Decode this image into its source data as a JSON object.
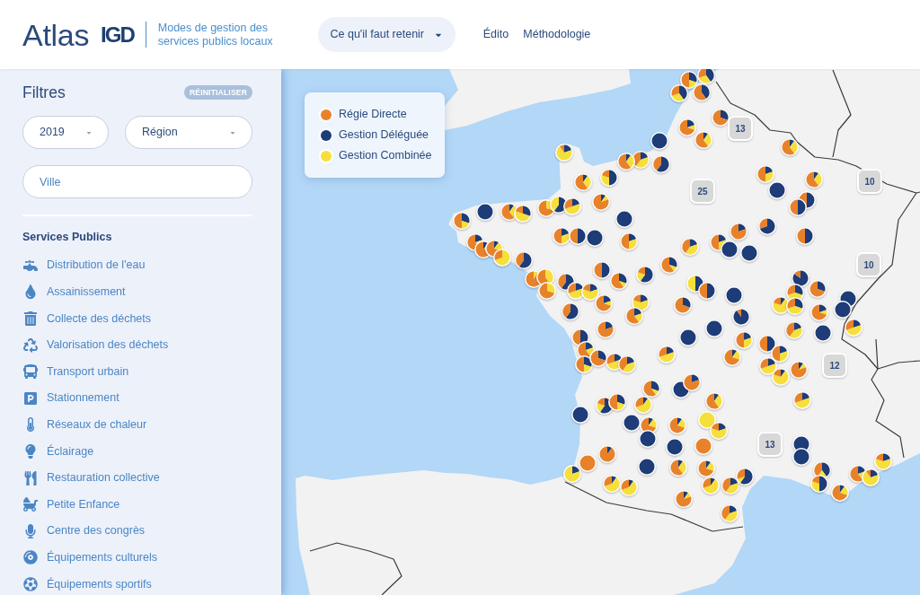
{
  "header": {
    "title": "Atlas",
    "brand": "IGD",
    "subtitle": "Modes de gestion des services publics locaux",
    "menu_button": "Ce qu'il faut retenir",
    "nav_links": [
      "Édito",
      "Méthodologie"
    ]
  },
  "sidebar": {
    "title": "Filtres",
    "reset_button": "RÉINITIALISER",
    "year_select": "2019",
    "region_select": "Région",
    "city_field": {
      "placeholder": "Ville"
    },
    "section_title": "Services Publics",
    "services": [
      "Distribution de l'eau",
      "Assainissement",
      "Collecte des déchets",
      "Valorisation des déchets",
      "Transport urbain",
      "Stationnement",
      "Réseaux de chaleur",
      "Éclairage",
      "Restauration collective",
      "Petite Enfance",
      "Centre des congrès",
      "Équipements culturels",
      "Équipements sportifs"
    ]
  },
  "map": {
    "legend": [
      {
        "label": "Régie Directe",
        "color": "#e8822a"
      },
      {
        "label": "Gestion Déléguée",
        "color": "#1d3c78"
      },
      {
        "label": "Gestion Combinée",
        "color": "#f6df3a"
      }
    ],
    "clusters": [
      "13",
      "25",
      "10",
      "10",
      "12",
      "13"
    ]
  }
}
